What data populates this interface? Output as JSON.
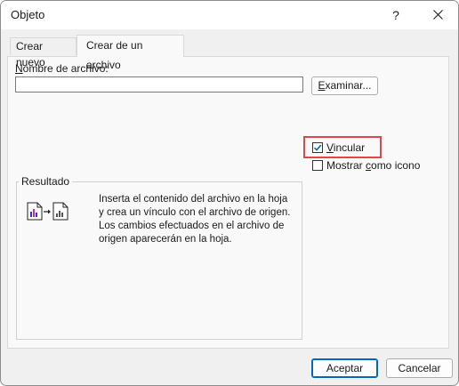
{
  "window": {
    "title": "Objeto",
    "help_glyph": "?",
    "close_icon": "close-icon"
  },
  "tabs": [
    {
      "label": "Crear nuevo",
      "active": false
    },
    {
      "label": "Crear de un archivo",
      "active": true
    }
  ],
  "file": {
    "label_access": "N",
    "label_rest": "ombre de archivo:",
    "value": "",
    "browse_access": "E",
    "browse_rest": "xaminar..."
  },
  "options": {
    "link_access": "V",
    "link_rest": "incular",
    "link_checked": true,
    "icon_pre": "Mostrar ",
    "icon_access": "c",
    "icon_post": "omo icono",
    "icon_checked": false
  },
  "result": {
    "legend": "Resultado",
    "text": "Inserta el contenido del archivo en la hoja\ny crea un vínculo con el archivo de origen.\nLos cambios efectuados en el archivo de\norigen aparecerán en la hoja.",
    "icon": "linked-file-icon"
  },
  "buttons": {
    "ok": "Aceptar",
    "cancel": "Cancelar"
  },
  "colors": {
    "accent": "#0067c0",
    "highlight": "#e0474c"
  }
}
